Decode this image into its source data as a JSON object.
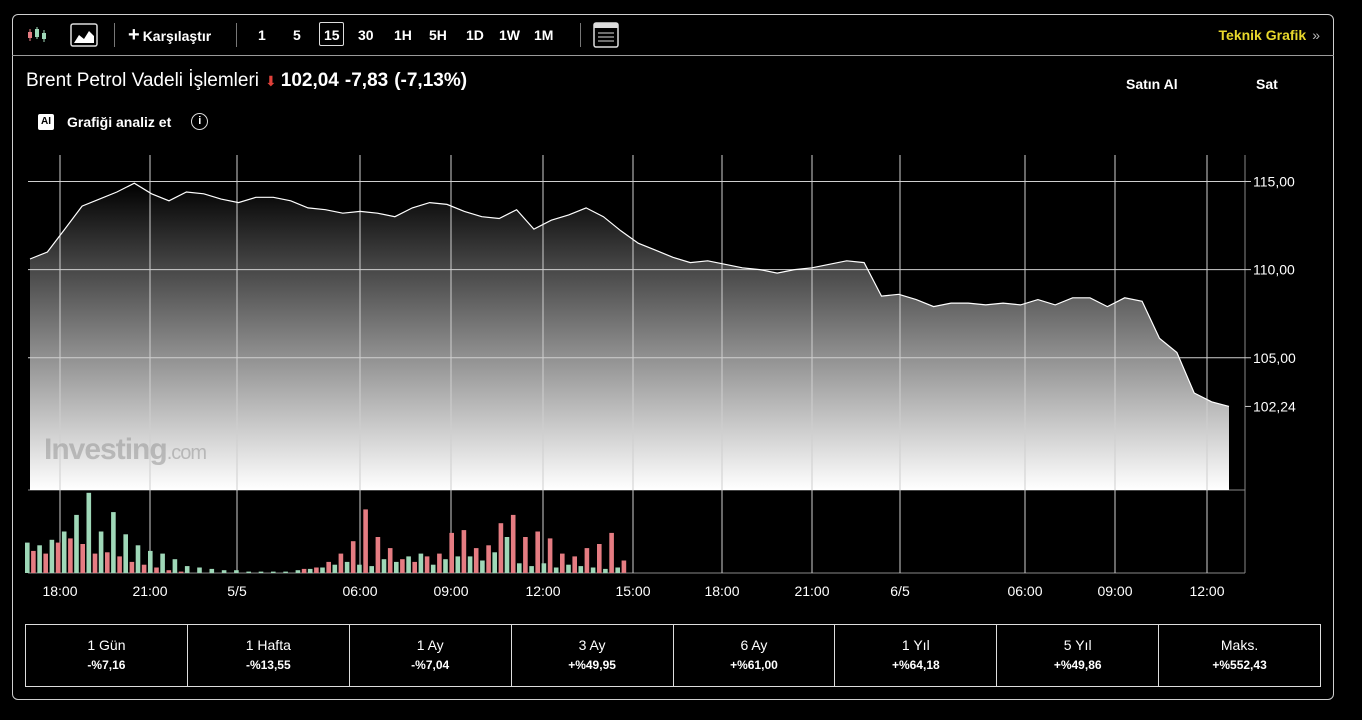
{
  "toolbar": {
    "compare_label": "Karşılaştır",
    "timeframes": [
      "1",
      "5",
      "15",
      "30",
      "1H",
      "5H",
      "1D",
      "1W",
      "1M"
    ],
    "selected_timeframe": "15",
    "technical_chart_label": "Teknik Grafik",
    "technical_chart_chevron": "»"
  },
  "instrument": {
    "name": "Brent Petrol Vadeli İşlemleri",
    "last": "102,04",
    "change": "-7,83",
    "change_pct": "(-7,13%)",
    "direction": "down"
  },
  "actions": {
    "buy_label": "Satın Al",
    "sell_label": "Sat"
  },
  "analyze": {
    "badge": "AI",
    "label": "Grafiği analiz et",
    "info": "i"
  },
  "watermark": {
    "brand": "Investing",
    "suffix": ".com"
  },
  "colors": {
    "background": "#000000",
    "line": "#ffffff",
    "volume_up": "#9fd8b8",
    "volume_down": "#e57c82",
    "accent": "#e8d82c",
    "down": "#e0413a"
  },
  "chart_data": {
    "type": "area",
    "ylim": [
      97.5,
      116.5
    ],
    "y_ticks": [
      115,
      110,
      105
    ],
    "y_tick_labels": [
      "115,00",
      "110,00",
      "105,00"
    ],
    "last_label": "102,24",
    "last_value": 102.24,
    "x_tick_labels": [
      "18:00",
      "21:00",
      "5/5",
      "06:00",
      "09:00",
      "12:00",
      "15:00",
      "18:00",
      "21:00",
      "6/5",
      "06:00",
      "09:00",
      "12:00"
    ],
    "grid": true,
    "values": [
      110.6,
      111.0,
      112.3,
      113.6,
      114.0,
      114.4,
      114.9,
      114.3,
      113.9,
      114.4,
      114.3,
      114.0,
      113.8,
      114.1,
      114.1,
      113.9,
      113.5,
      113.4,
      113.2,
      113.3,
      113.2,
      113.0,
      113.5,
      113.8,
      113.7,
      113.3,
      113.0,
      112.9,
      113.4,
      112.3,
      112.8,
      113.1,
      113.5,
      113.0,
      112.2,
      111.5,
      111.1,
      110.7,
      110.4,
      110.5,
      110.3,
      110.1,
      110.0,
      109.8,
      110.0,
      110.1,
      110.3,
      110.5,
      110.4,
      108.5,
      108.6,
      108.3,
      107.9,
      108.1,
      108.1,
      108.0,
      108.1,
      108.0,
      108.3,
      108.0,
      108.4,
      108.4,
      107.9,
      108.4,
      108.2,
      106.1,
      105.3,
      103.0,
      102.5,
      102.24
    ],
    "volume_series": [
      {
        "name": "up",
        "values": [
          22,
          20,
          24,
          30,
          42,
          58,
          30,
          44,
          28,
          20,
          16,
          14,
          10,
          5,
          4,
          3,
          2,
          2,
          1,
          1,
          1,
          1,
          2,
          3,
          4,
          6,
          8,
          6,
          5,
          10,
          8,
          12,
          14,
          6,
          10,
          12,
          12,
          9,
          15,
          26,
          7,
          5,
          7,
          4,
          6,
          5,
          4,
          3,
          4
        ]
      },
      {
        "name": "down",
        "values": [
          16,
          14,
          22,
          25,
          21,
          14,
          15,
          12,
          8,
          6,
          4,
          2,
          1,
          0,
          0,
          0,
          0,
          0,
          0,
          0,
          0,
          0,
          3,
          4,
          8,
          14,
          23,
          46,
          26,
          18,
          10,
          8,
          12,
          14,
          29,
          31,
          18,
          20,
          36,
          42,
          26,
          30,
          25,
          14,
          12,
          18,
          21,
          29,
          9
        ]
      }
    ]
  },
  "performance": [
    {
      "label": "1 Gün",
      "value": "-%7,16"
    },
    {
      "label": "1 Hafta",
      "value": "-%13,55"
    },
    {
      "label": "1 Ay",
      "value": "-%7,04"
    },
    {
      "label": "3 Ay",
      "value": "+%49,95"
    },
    {
      "label": "6 Ay",
      "value": "+%61,00"
    },
    {
      "label": "1 Yıl",
      "value": "+%64,18"
    },
    {
      "label": "5 Yıl",
      "value": "+%49,86"
    },
    {
      "label": "Maks.",
      "value": "+%552,43"
    }
  ]
}
